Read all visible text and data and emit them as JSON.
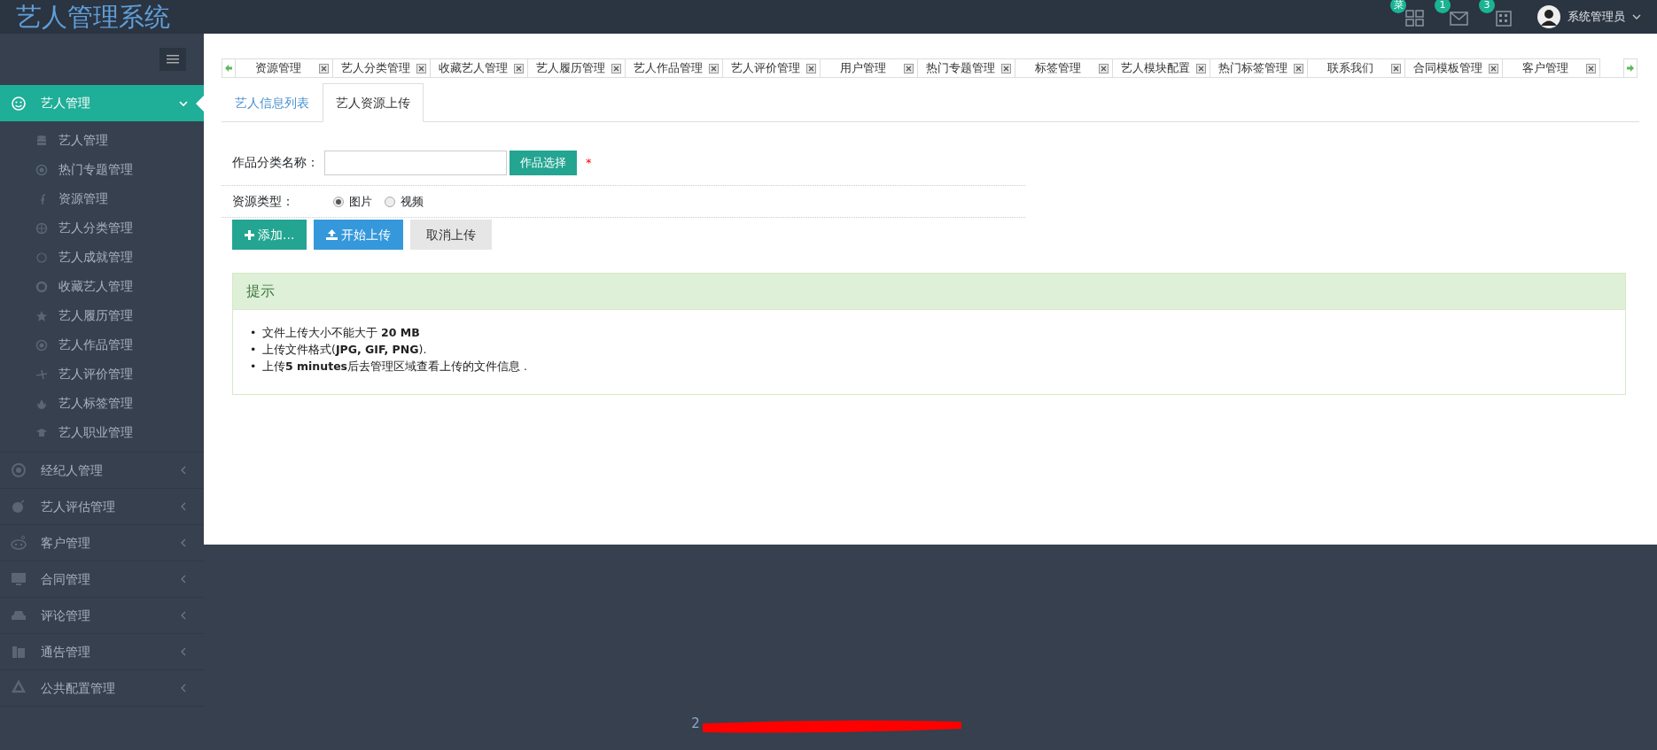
{
  "header": {
    "title": "艺人管理系统",
    "notifications": [
      {
        "badge": "菜"
      },
      {
        "badge": "1"
      },
      {
        "badge": "3"
      }
    ],
    "user": "系统管理员"
  },
  "sidebar": {
    "items": [
      {
        "label": "艺人管理",
        "expanded": true,
        "selected": true,
        "children": [
          {
            "label": "艺人管理"
          },
          {
            "label": "热门专题管理"
          },
          {
            "label": "资源管理"
          },
          {
            "label": "艺人分类管理"
          },
          {
            "label": "艺人成就管理"
          },
          {
            "label": "收藏艺人管理"
          },
          {
            "label": "艺人履历管理"
          },
          {
            "label": "艺人作品管理"
          },
          {
            "label": "艺人评价管理"
          },
          {
            "label": "艺人标签管理"
          },
          {
            "label": "艺人职业管理"
          }
        ]
      },
      {
        "label": "经纪人管理",
        "expanded": false,
        "selected": false
      },
      {
        "label": "艺人评估管理",
        "expanded": false,
        "selected": false
      },
      {
        "label": "客户管理",
        "expanded": false,
        "selected": false
      },
      {
        "label": "合同管理",
        "expanded": false,
        "selected": false
      },
      {
        "label": "评论管理",
        "expanded": false,
        "selected": false
      },
      {
        "label": "通告管理",
        "expanded": false,
        "selected": false
      },
      {
        "label": "公共配置管理",
        "expanded": false,
        "selected": false
      }
    ]
  },
  "page_tabs": [
    "资源管理",
    "艺人分类管理",
    "收藏艺人管理",
    "艺人履历管理",
    "艺人作品管理",
    "艺人评价管理",
    "用户管理",
    "热门专题管理",
    "标签管理",
    "艺人模块配置",
    "热门标签管理",
    "联系我们",
    "合同模板管理",
    "客户管理"
  ],
  "sub_tabs": [
    {
      "label": "艺人信息列表",
      "selected": false
    },
    {
      "label": "艺人资源上传",
      "selected": true
    }
  ],
  "form": {
    "category_label": "作品分类名称：",
    "choose_button": "作品选择",
    "required_mark": "*",
    "type_label": "资源类型：",
    "type_options": [
      {
        "label": "图片",
        "selected": true
      },
      {
        "label": "视频",
        "selected": false
      }
    ],
    "buttons": [
      {
        "kind": "add",
        "label": "添加..."
      },
      {
        "kind": "upload",
        "label": "开始上传"
      },
      {
        "kind": "cancel",
        "label": "取消上传"
      }
    ]
  },
  "hint": {
    "title": "提示",
    "items": [
      {
        "bullet": "•",
        "text": "文件上传大小不能大于 **20 MB**"
      },
      {
        "bullet": "•",
        "text": "上传文件格式(**JPG, GIF, PNG**)."
      },
      {
        "bullet": "•",
        "text": "上传**5 minutes**后去管理区域查看上传的文件信息 ."
      }
    ]
  },
  "footer": {
    "text": "2"
  }
}
